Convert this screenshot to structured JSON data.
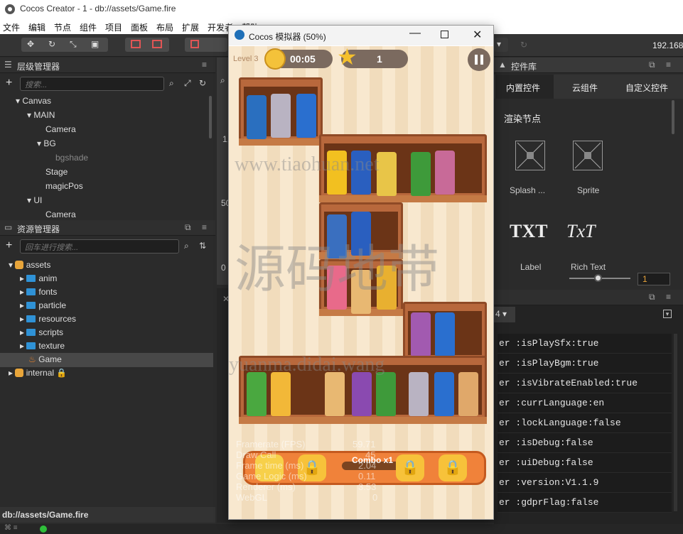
{
  "window_title": "Cocos Creator - 1 - db://assets/Game.fire",
  "menu": [
    "文件",
    "编辑",
    "节点",
    "组件",
    "项目",
    "面板",
    "布局",
    "扩展",
    "开发者",
    "帮助"
  ],
  "toolbar": {
    "ip": "192.168"
  },
  "hierarchy": {
    "title": "层级管理器",
    "search_placeholder": "搜索...",
    "nodes": [
      "Canvas",
      "MAIN",
      "Camera",
      "BG",
      "bgshade",
      "Stage",
      "magicPos",
      "UI",
      "Camera"
    ]
  },
  "assets": {
    "title": "资源管理器",
    "search_placeholder": "回车进行搜索...",
    "root": "assets",
    "items": [
      "anim",
      "fonts",
      "particle",
      "resources",
      "scripts",
      "texture",
      "Game",
      "internal"
    ]
  },
  "status_path": "db://assets/Game.fire",
  "simulator": {
    "title": "Cocos 模拟器 (50%)",
    "level_label": "Level 3",
    "timer": "00:05",
    "stars": "1",
    "combo_label": "Combo x1",
    "stats": [
      {
        "label": "Framerate (FPS)",
        "value": "59.71"
      },
      {
        "label": "Draw Call",
        "value": "45"
      },
      {
        "label": "Frame time (ms)",
        "value": "2.04"
      },
      {
        "label": "Game Logic (ms)",
        "value": "0.11"
      },
      {
        "label": "Renderer (ms)",
        "value": "3.53"
      },
      {
        "label": "WebGL",
        "value": "0"
      }
    ]
  },
  "scene_partial": {
    "ruler_1": "1,",
    "ruler_50": "50",
    "ruler_0": "0"
  },
  "widgets": {
    "title": "控件库",
    "tabs": [
      "内置控件",
      "云组件",
      "自定义控件"
    ],
    "section": "渲染节点",
    "items": [
      {
        "label": "Splash ...",
        "icon": "splash-sprite-icon"
      },
      {
        "label": "Sprite",
        "icon": "sprite-icon"
      },
      {
        "label": "Label",
        "glyph": "TXT"
      },
      {
        "label": "Rich Text",
        "glyph": "TxT"
      }
    ],
    "zoom_value": "1"
  },
  "console": {
    "dropdown_value": "4",
    "lines": [
      "er :isPlaySfx:true",
      "er :isPlayBgm:true",
      "er :isVibrateEnabled:true",
      "er :currLanguage:en",
      "er :lockLanguage:false",
      "er :isDebug:false",
      "er :uiDebug:false",
      "er :version:V1.1.9",
      "er :gdprFlag:false"
    ]
  },
  "watermarks": [
    "www.tiaohuan.net",
    "源码地带",
    "yuanma.didai.wang"
  ],
  "colors": {
    "accent": "#2f92d6",
    "panel": "#2b2b2b",
    "shelf": "#b8683c"
  }
}
